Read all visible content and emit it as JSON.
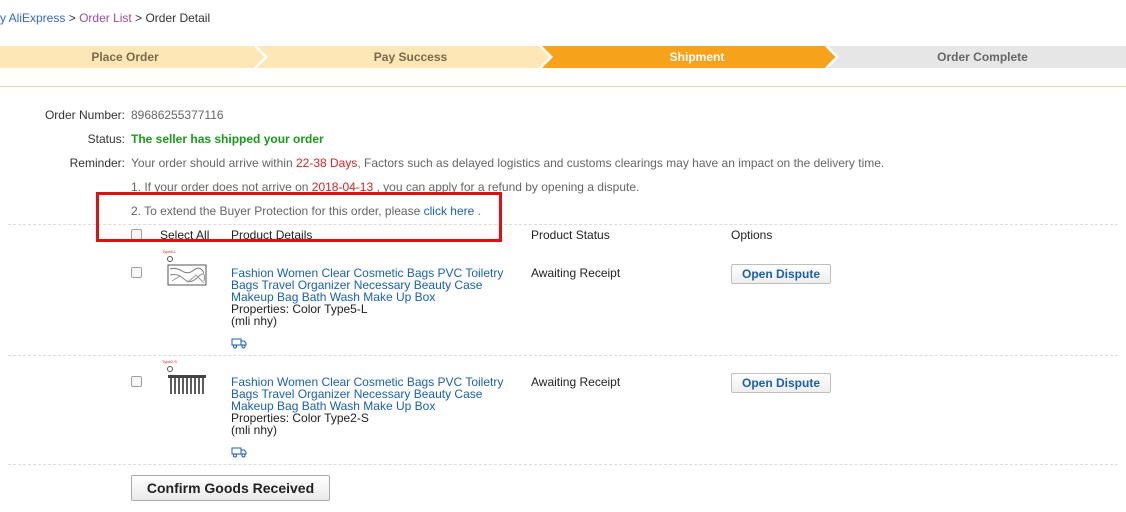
{
  "breadcrumb": {
    "home": "y AliExpress",
    "sep1": ">",
    "order_list": "Order List",
    "sep2": ">",
    "current": "Order Detail"
  },
  "steps": [
    {
      "label": "Place Order",
      "state": "done"
    },
    {
      "label": "Pay Success",
      "state": "done"
    },
    {
      "label": "Shipment",
      "state": "current"
    },
    {
      "label": "Order Complete",
      "state": "pending"
    }
  ],
  "colors": {
    "done": "#fde7b6",
    "current": "#f7a21b",
    "pending": "#e6e6e6",
    "text_done": "#7a6a4a"
  },
  "order": {
    "number_label": "Order Number:",
    "number": "89686255377116",
    "status_label": "Status:",
    "status": "The seller has shipped your order",
    "reminder_label": "Reminder:",
    "reminder_pre": "Your order should arrive within ",
    "reminder_days": "22-38 Days",
    "reminder_post": ", Factors such as delayed logistics and customs clearings may have an impact on the delivery time.",
    "note1_pre": "1. If your order does not arrive on ",
    "note1_date": "2018-04-13",
    "note1_post": " , you can apply for a refund by opening a dispute.",
    "note2_pre": "2. To extend the Buyer Protection for this order, please ",
    "note2_link": "click here",
    "note2_post": " ."
  },
  "table": {
    "select_all": "Select All",
    "col_details": "Product Details",
    "col_status": "Product Status",
    "col_options": "Options"
  },
  "products": [
    {
      "title_line1": "Fashion Women Clear Cosmetic Bags PVC Toiletry",
      "title_line2": "Bags Travel Organizer Necessary Beauty Case",
      "title_line3": "Makeup Bag Bath Wash Make Up Box",
      "properties": "Properties: Color Type5-L",
      "extra": "(mli nhy)",
      "status": "Awaiting Receipt",
      "action": "Open Dispute",
      "thumb_tag": "Type5-L"
    },
    {
      "title_line1": "Fashion Women Clear Cosmetic Bags PVC Toiletry",
      "title_line2": "Bags Travel Organizer Necessary Beauty Case",
      "title_line3": "Makeup Bag Bath Wash Make Up Box",
      "properties": "Properties: Color Type2-S",
      "extra": "(mli nhy)",
      "status": "Awaiting Receipt",
      "action": "Open Dispute",
      "thumb_tag": "Type2-S"
    }
  ],
  "confirm_button": "Confirm Goods Received"
}
